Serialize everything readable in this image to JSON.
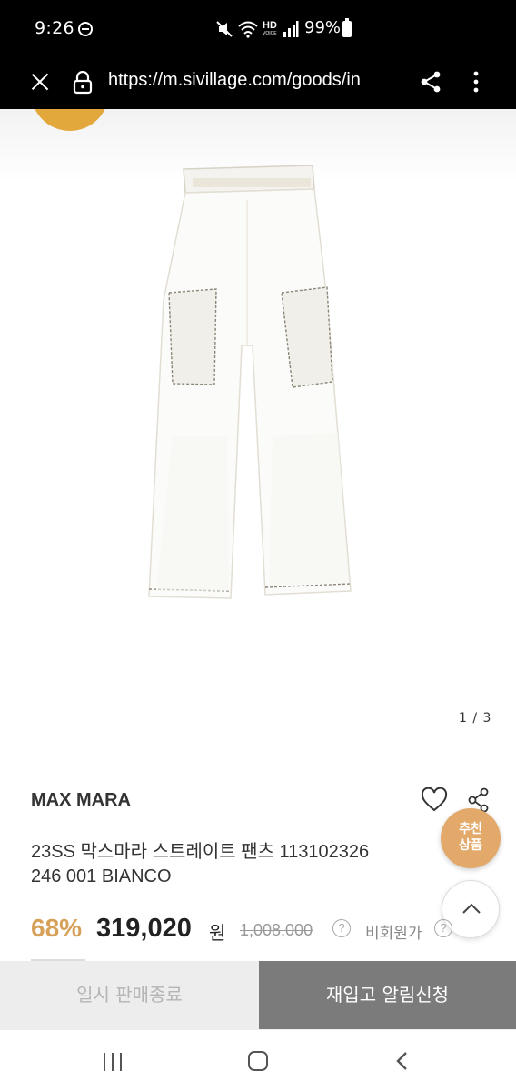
{
  "status_bar": {
    "time": "9:26",
    "battery": "99%",
    "hd_label": "HD",
    "hd_sub": "VOICE"
  },
  "browser": {
    "url": "https://m.sivillage.com/goods/in"
  },
  "gallery": {
    "pager": "1 / 3"
  },
  "product": {
    "brand": "MAX MARA",
    "title_line1": "23SS 막스마라 스트레이트 팬츠 113102326",
    "title_line2": "246 001 BIANCO",
    "discount": "68%",
    "price": "319,020",
    "price_unit": "원",
    "original_price": "1,008,000",
    "help_mark": "?",
    "non_member_label": "비회원가"
  },
  "floating": {
    "recommend_line1": "추천",
    "recommend_line2": "상품"
  },
  "actions": {
    "sold_out_label": "일시 판매종료",
    "restock_label": "재입고 알림신청"
  },
  "colors": {
    "accent_gold": "#d6a058",
    "badge": "#e2a96a",
    "restock_button": "#7b7b7b"
  },
  "icons": [
    "close-icon",
    "lock-icon",
    "share-icon",
    "more-vert-icon",
    "heart-icon",
    "share-icon",
    "chevron-up-icon",
    "help-icon",
    "recent-apps-icon",
    "home-icon",
    "back-icon"
  ]
}
